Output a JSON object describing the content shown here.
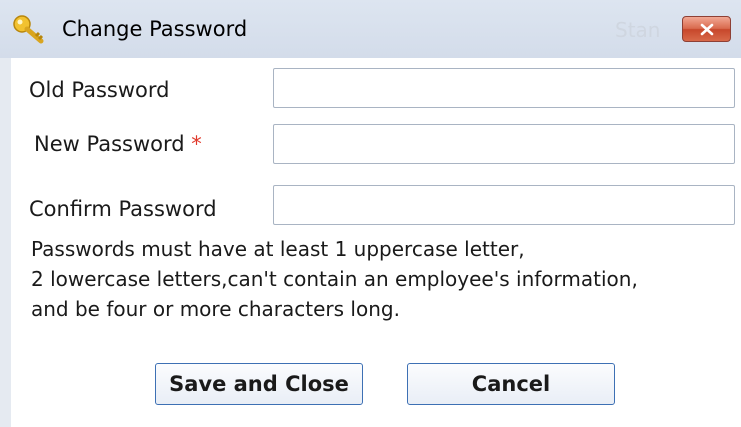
{
  "dialog": {
    "title": "Change Password",
    "title_icon": "key-icon",
    "close_icon": "close-icon",
    "ghost_text": "Stan"
  },
  "form": {
    "old_password_label": "Old Password",
    "new_password_label": "New Password",
    "required_marker": "*",
    "confirm_password_label": "Confirm Password",
    "old_password_value": "",
    "new_password_value": "",
    "confirm_password_value": ""
  },
  "note": {
    "line1": "Passwords must have at least 1 uppercase letter,",
    "line2": "2 lowercase letters,can't contain an employee's information,",
    "line3": "and be four or more characters long."
  },
  "buttons": {
    "save_label": "Save and Close",
    "cancel_label": "Cancel"
  },
  "colors": {
    "titlebar": "#d3dcea",
    "close_button": "#c7472b",
    "required_marker": "#e0392b",
    "button_border": "#3d70b4"
  }
}
